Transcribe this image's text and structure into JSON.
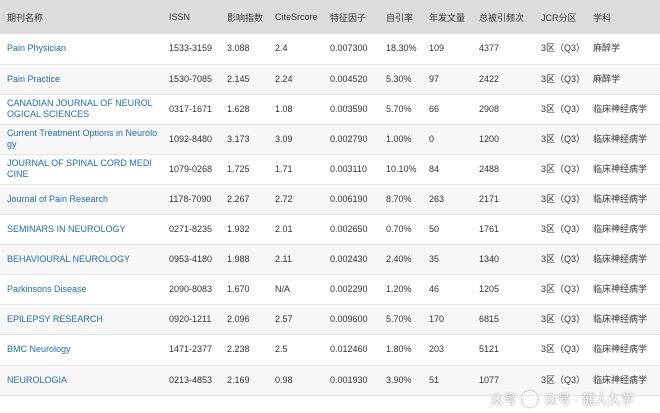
{
  "headers": [
    "期刊名称",
    "ISSN",
    "影响指数",
    "CiteSrcore",
    "特征因子",
    "自引率",
    "年发文量",
    "总被引频次",
    "JCR分区",
    "学科"
  ],
  "rows": [
    {
      "name": "Pain Physician",
      "issn": "1533-3159",
      "impact": "3.088",
      "citescore": "2.4",
      "eigen": "0.007300",
      "self": "18.30%",
      "annual": "109",
      "cites": "4377",
      "jcr": "3区（Q3）",
      "subject": "麻醉学"
    },
    {
      "name": "Pain Practice",
      "issn": "1530-7085",
      "impact": "2.145",
      "citescore": "2.24",
      "eigen": "0.004520",
      "self": "5.30%",
      "annual": "97",
      "cites": "2422",
      "jcr": "3区（Q3）",
      "subject": "麻醉学"
    },
    {
      "name": "CANADIAN JOURNAL OF NEUROLOGICAL SCIENCES",
      "issn": "0317-1671",
      "impact": "1.628",
      "citescore": "1.08",
      "eigen": "0.003590",
      "self": "5.70%",
      "annual": "66",
      "cites": "2908",
      "jcr": "3区（Q3）",
      "subject": "临床神经病学"
    },
    {
      "name": "Current Treatment Options in Neurology",
      "issn": "1092-8480",
      "impact": "3.173",
      "citescore": "3.09",
      "eigen": "0.002790",
      "self": "1.00%",
      "annual": "0",
      "cites": "1200",
      "jcr": "3区（Q3）",
      "subject": "临床神经病学"
    },
    {
      "name": "JOURNAL OF SPINAL CORD MEDICINE",
      "issn": "1079-0268",
      "impact": "1.725",
      "citescore": "1.71",
      "eigen": "0.003110",
      "self": "10.10%",
      "annual": "84",
      "cites": "2488",
      "jcr": "3区（Q3）",
      "subject": "临床神经病学"
    },
    {
      "name": "Journal of Pain Research",
      "issn": "1178-7090",
      "impact": "2.267",
      "citescore": "2.72",
      "eigen": "0.006190",
      "self": "8.70%",
      "annual": "263",
      "cites": "2171",
      "jcr": "3区（Q3）",
      "subject": "临床神经病学"
    },
    {
      "name": "SEMINARS IN NEUROLOGY",
      "issn": "0271-8235",
      "impact": "1.932",
      "citescore": "2.01",
      "eigen": "0.002650",
      "self": "0.70%",
      "annual": "50",
      "cites": "1761",
      "jcr": "3区（Q3）",
      "subject": "临床神经病学"
    },
    {
      "name": "BEHAVIOURAL NEUROLOGY",
      "issn": "0953-4180",
      "impact": "1.988",
      "citescore": "2.11",
      "eigen": "0.002430",
      "self": "2.40%",
      "annual": "35",
      "cites": "1340",
      "jcr": "3区（Q3）",
      "subject": "临床神经病学"
    },
    {
      "name": "Parkinsons Disease",
      "issn": "2090-8083",
      "impact": "1.670",
      "citescore": "N/A",
      "eigen": "0.002290",
      "self": "1.20%",
      "annual": "46",
      "cites": "1205",
      "jcr": "3区（Q3）",
      "subject": "临床神经病学"
    },
    {
      "name": "EPILEPSY RESEARCH",
      "issn": "0920-1211",
      "impact": "2.096",
      "citescore": "2.57",
      "eigen": "0.009600",
      "self": "5.70%",
      "annual": "170",
      "cites": "6815",
      "jcr": "3区（Q3）",
      "subject": "临床神经病学"
    },
    {
      "name": "BMC Neurology",
      "issn": "1471-2377",
      "impact": "2.238",
      "citescore": "2.5",
      "eigen": "0.012460",
      "self": "1.80%",
      "annual": "203",
      "cites": "5121",
      "jcr": "3区（Q3）",
      "subject": "临床神经病学"
    },
    {
      "name": "NEUROLOGIA",
      "issn": "0213-4853",
      "impact": "2.169",
      "citescore": "0.98",
      "eigen": "0.001930",
      "self": "3.90%",
      "annual": "51",
      "cites": "1077",
      "jcr": "3区（Q3）",
      "subject": "临床神经病学"
    }
  ],
  "watermark": {
    "text": "众号 · 健人久学",
    "prefix": "众号"
  },
  "colors": {
    "link": "#1f6fae",
    "header_bg": "#dcdcdc",
    "row_alt": "#f7f7f7"
  }
}
